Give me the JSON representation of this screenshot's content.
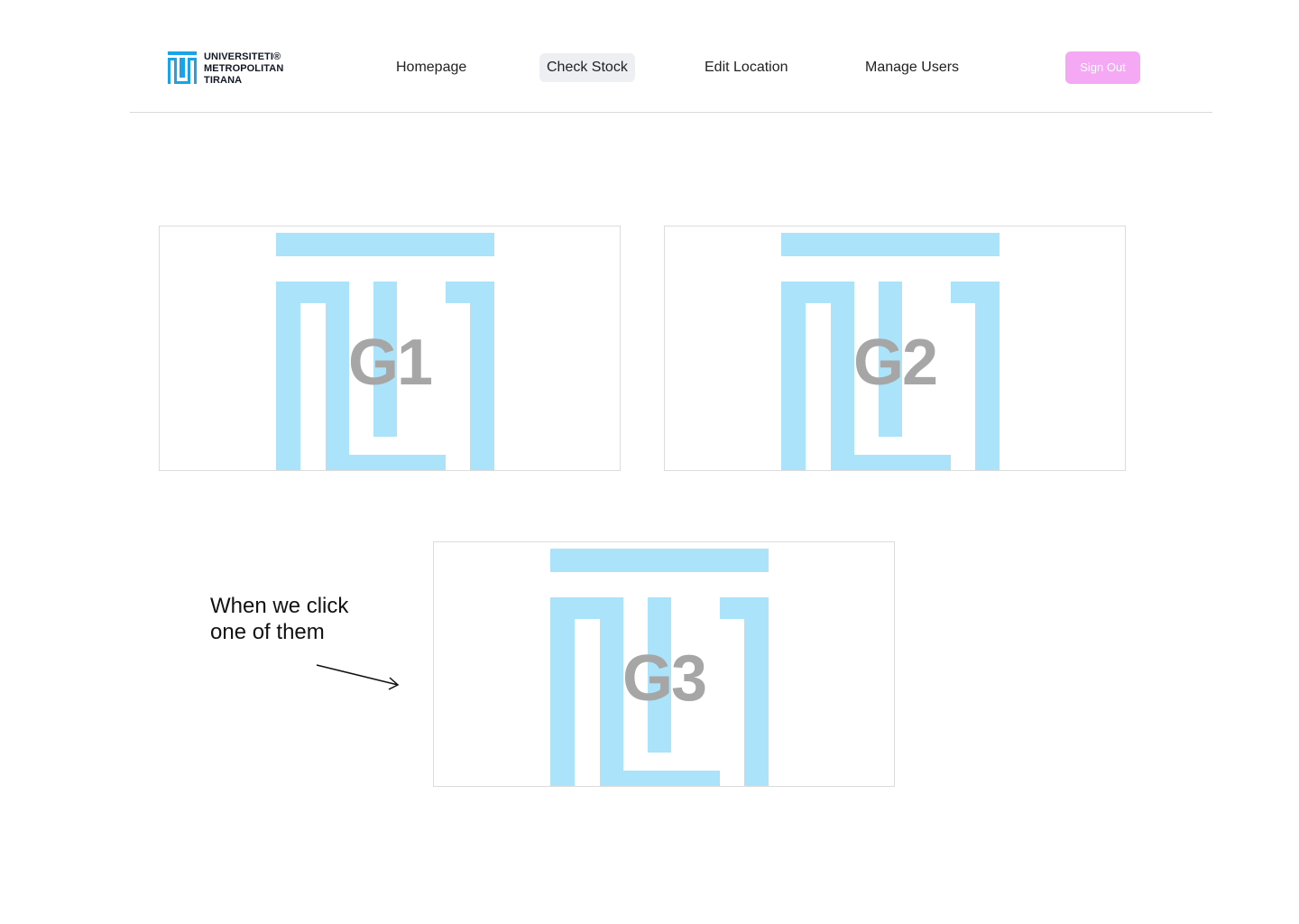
{
  "header": {
    "logo": {
      "line1": "UNIVERSITETI®",
      "line2": "METROPOLITAN",
      "line3": "TIRANA",
      "icon": "umt-logo-icon",
      "color": "#1aa3e8"
    },
    "nav": [
      {
        "label": "Homepage",
        "active": false
      },
      {
        "label": "Check Stock",
        "active": true
      },
      {
        "label": "Edit Location",
        "active": false
      },
      {
        "label": "Manage Users",
        "active": false
      }
    ],
    "sign_out_label": "Sign Out",
    "sign_out_color": "#f5a9f5"
  },
  "cards": [
    {
      "label": "G1"
    },
    {
      "label": "G2"
    },
    {
      "label": "G3"
    }
  ],
  "watermark_color": "#abe3fb",
  "annotation": {
    "line1": "When we click",
    "line2": "one of them",
    "icon": "arrow-right-icon"
  }
}
